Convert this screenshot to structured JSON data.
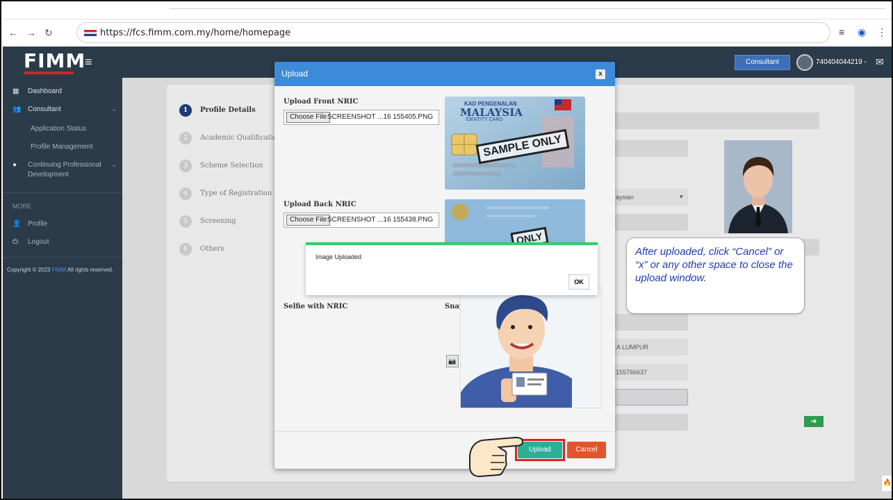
{
  "browser": {
    "url": "https://fcs.fimm.com.my/home/homepage",
    "icons": [
      "back-icon",
      "forward-icon",
      "reload-icon",
      "favicon",
      "media-icon",
      "profile-icon",
      "menu-icon"
    ]
  },
  "topnav": {
    "logo": "FIMM",
    "consultant_label": "Consultant",
    "user_id": "740404044219 -"
  },
  "sidebar": {
    "items": [
      {
        "label": "Dashboard",
        "icon": "dashboard-icon"
      },
      {
        "label": "Consultant",
        "icon": "users-icon"
      },
      {
        "label": "Application Status"
      },
      {
        "label": "Profile Management"
      },
      {
        "label": "Continuing Professional",
        "icon": "circle-icon"
      },
      {
        "label": "Development"
      }
    ],
    "section_label": "MORE",
    "more_items": [
      {
        "label": "Profile",
        "icon": "user-icon"
      },
      {
        "label": "Logout",
        "icon": "power-icon"
      }
    ],
    "copyright_pre": "Copyright © 2023",
    "copyright_brand": "FIMM",
    "copyright_post": "All rights reserved."
  },
  "steps": [
    {
      "num": "1",
      "label": "Profile Details"
    },
    {
      "num": "2",
      "label": "Academic Qualifications"
    },
    {
      "num": "3",
      "label": "Scheme Selection"
    },
    {
      "num": "4",
      "label": "Type of Registration"
    },
    {
      "num": "5",
      "label": "Screening"
    },
    {
      "num": "6",
      "label": "Others"
    }
  ],
  "background_values": {
    "nationality": "aysian",
    "city": "LA LUMPUR",
    "phone": "155766637"
  },
  "modal": {
    "title": "Upload",
    "close": "x",
    "front_label": "Upload Front NRIC",
    "back_label": "Upload Back NRIC",
    "choose_file": "Choose File",
    "front_file": "SCREENSHOT ...16 155405.PNG",
    "back_file": "SCREENSHOT ...16 155438.PNG",
    "nric_header": "KAD PENGENALAN",
    "nric_country": "MALAYSIA",
    "nric_sub": "IDENTITY CARD",
    "nric_stamp": "SAMPLE ONLY",
    "nric_stamp_back": "ONLY",
    "selfie_label": "Selfie with NRIC",
    "snap_label": "Snap Selfie with NRIC",
    "upload_btn": "Upload",
    "cancel_btn": "Cancel"
  },
  "alert": {
    "message": "Image Uploaded",
    "ok": "OK"
  },
  "callout": {
    "text": "After uploaded, click “Cancel” or “x” or any other space to close the upload window."
  },
  "colors": {
    "sidebar": "#2c3b4a",
    "modal_header": "#3d8bd8",
    "upload": "#2bb096",
    "cancel": "#e2552c",
    "callout_text": "#1f3bb3",
    "highlight": "#e32020"
  }
}
